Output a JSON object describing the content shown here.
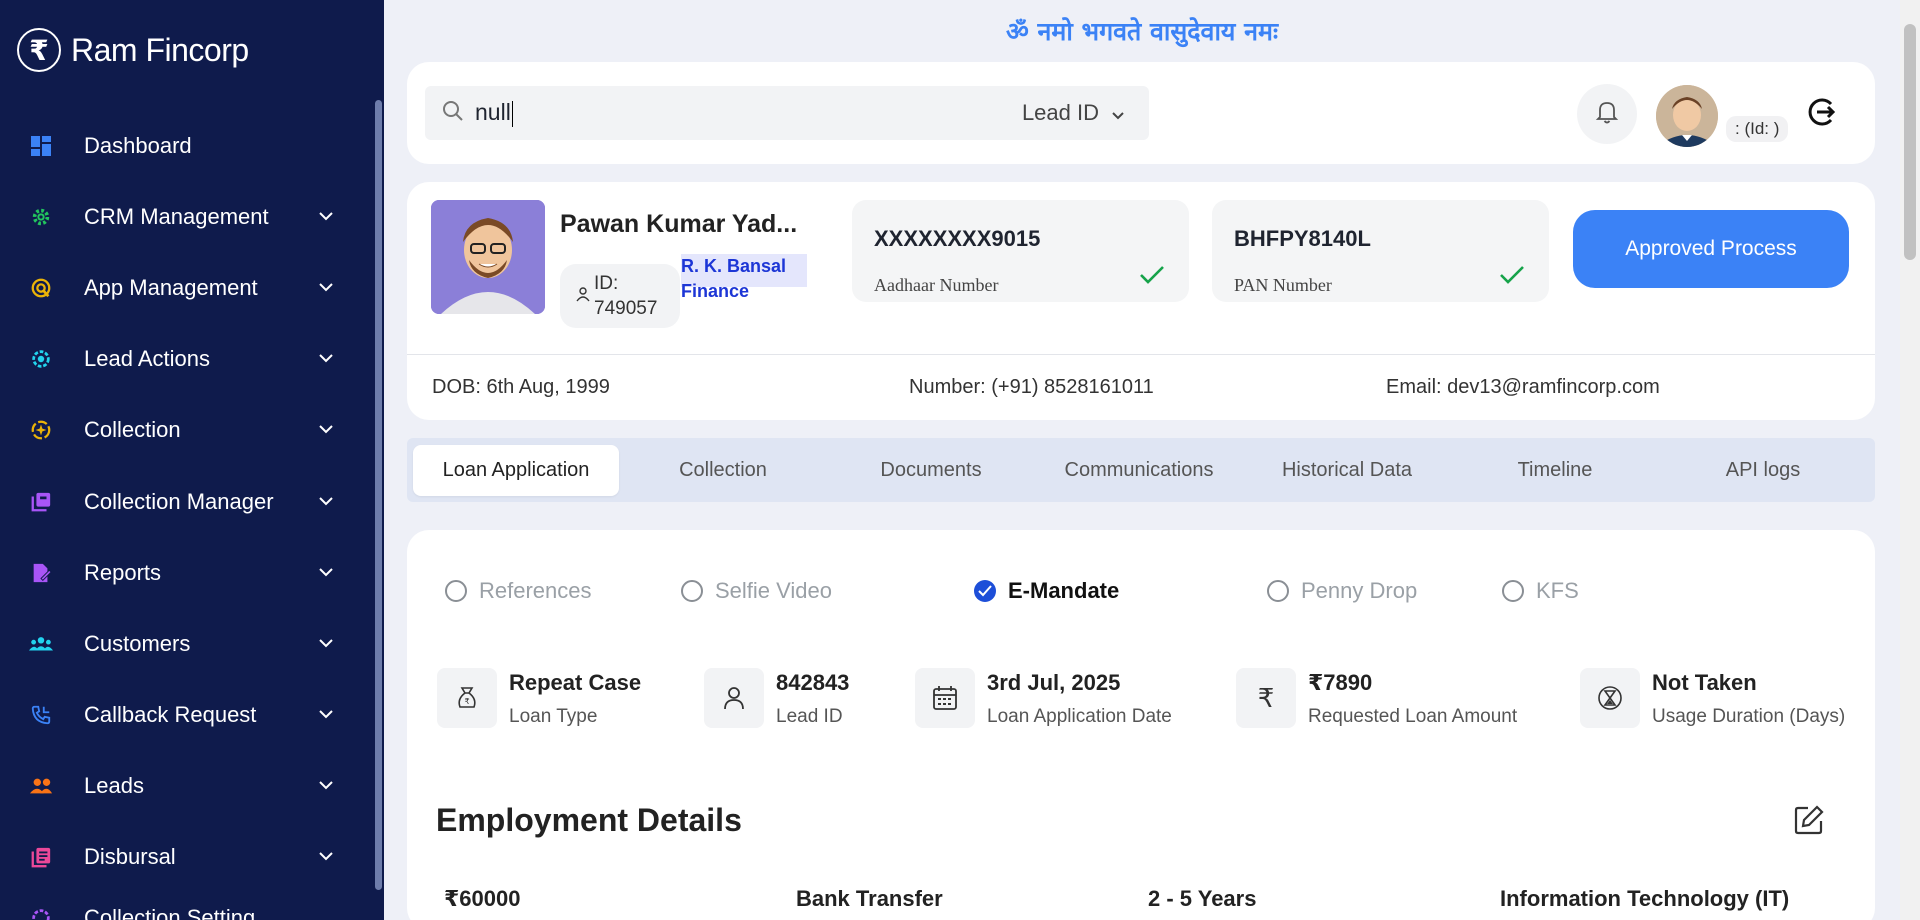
{
  "brand": {
    "icon": "₹",
    "name": "Ram Fincorp"
  },
  "sidebar": {
    "items": [
      {
        "label": "Dashboard",
        "icon": "dashboard-icon",
        "color": "#3b82f6",
        "chevron": false
      },
      {
        "label": "CRM Management",
        "icon": "gear-icon",
        "color": "#22c55e",
        "chevron": true
      },
      {
        "label": "App Management",
        "icon": "app-icon",
        "color": "#eab308",
        "chevron": true
      },
      {
        "label": "Lead Actions",
        "icon": "lead-actions-icon",
        "color": "#22d3ee",
        "chevron": true
      },
      {
        "label": "Collection",
        "icon": "collection-icon",
        "color": "#eab308",
        "chevron": true
      },
      {
        "label": "Collection Manager",
        "icon": "collection-manager-icon",
        "color": "#a855f7",
        "chevron": true
      },
      {
        "label": "Reports",
        "icon": "reports-icon",
        "color": "#a855f7",
        "chevron": true
      },
      {
        "label": "Customers",
        "icon": "customers-icon",
        "color": "#22d3ee",
        "chevron": true
      },
      {
        "label": "Callback Request",
        "icon": "phone-icon",
        "color": "#3b82f6",
        "chevron": true
      },
      {
        "label": "Leads",
        "icon": "leads-icon",
        "color": "#f97316",
        "chevron": true
      },
      {
        "label": "Disbursal",
        "icon": "disbursal-icon",
        "color": "#ec4899",
        "chevron": true
      },
      {
        "label": "Collection Setting",
        "icon": "collection-setting-icon",
        "color": "#a855f7",
        "chevron": false
      }
    ]
  },
  "mantra": "ॐ नमो भगवते वासुदेवाय नमः",
  "search": {
    "value": "null",
    "type_label": "Lead ID"
  },
  "user": {
    "id_chip": ": (Id: )"
  },
  "profile": {
    "name": "Pawan Kumar Yad...",
    "id_prefix": "ID:",
    "id_value": "749057",
    "company": "R. K. Bansal Finance",
    "aadhaar": {
      "value": "XXXXXXXX9015",
      "label": "Aadhaar Number"
    },
    "pan": {
      "value": "BHFPY8140L",
      "label": "PAN Number"
    },
    "approve_label": "Approved Process",
    "dob": "DOB: 6th Aug, 1999",
    "number": "Number: (+91) 8528161011",
    "email": "Email: dev13@ramfincorp.com"
  },
  "tabs": [
    "Loan Application",
    "Collection",
    "Documents",
    "Communications",
    "Historical Data",
    "Timeline",
    "API logs"
  ],
  "steps": [
    {
      "label": "References",
      "checked": false
    },
    {
      "label": "Selfie Video",
      "checked": false
    },
    {
      "label": "E-Mandate",
      "checked": true
    },
    {
      "label": "Penny Drop",
      "checked": false
    },
    {
      "label": "KFS",
      "checked": false
    }
  ],
  "stats": [
    {
      "value": "Repeat Case",
      "label": "Loan Type",
      "icon": "money-bag-icon"
    },
    {
      "value": "842843",
      "label": "Lead ID",
      "icon": "user-icon"
    },
    {
      "value": "3rd Jul, 2025",
      "label": "Loan Application Date",
      "icon": "calendar-icon"
    },
    {
      "value": "₹7890",
      "label": "Requested Loan Amount",
      "icon": "rupee-icon"
    },
    {
      "value": "Not Taken",
      "label": "Usage Duration (Days)",
      "icon": "hourglass-icon"
    }
  ],
  "employment": {
    "title": "Employment Details",
    "values": [
      "₹60000",
      "Bank Transfer",
      "2 - 5 Years",
      "Information Technology (IT)"
    ]
  }
}
